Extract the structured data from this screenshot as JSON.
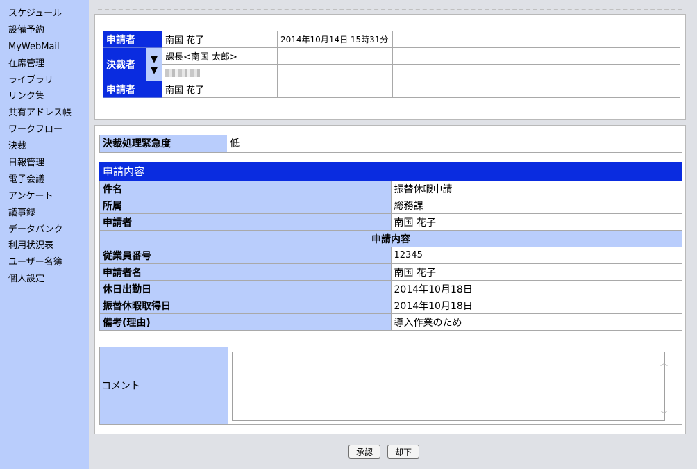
{
  "sidebar": {
    "items": [
      "スケジュール",
      "設備予約",
      "MyWebMail",
      "在席管理",
      "ライブラリ",
      "リンク集",
      "共有アドレス帳",
      "ワークフロー",
      "決裁",
      "日報管理",
      "電子会議",
      "アンケート",
      "議事録",
      "データバンク",
      "利用状況表",
      "ユーザー名簿",
      "個人設定"
    ]
  },
  "route": {
    "applicant_label": "申請者",
    "approver_label": "決裁者",
    "applicant_name": "南国 花子",
    "applied_at": "2014年10月14日 15時31分",
    "approver1": "課長<南国 太郎>",
    "final_label": "申請者",
    "final_name": "南国 花子",
    "arrow": "▼"
  },
  "urgency": {
    "label": "決裁処理緊急度",
    "value": "低"
  },
  "details": {
    "title": "申請内容",
    "rows": [
      {
        "k": "件名",
        "v": "振替休暇申請"
      },
      {
        "k": "所属",
        "v": "総務課"
      },
      {
        "k": "申請者",
        "v": "南国 花子"
      }
    ],
    "subheader": "申請内容",
    "rows2": [
      {
        "k": "従業員番号",
        "v": "12345"
      },
      {
        "k": "申請者名",
        "v": "南国 花子"
      },
      {
        "k": "休日出勤日",
        "v": "2014年10月18日"
      },
      {
        "k": "振替休暇取得日",
        "v": "2014年10月18日"
      },
      {
        "k": "備考(理由)",
        "v": "導入作業のため"
      }
    ]
  },
  "comment": {
    "label": "コメント",
    "value": "",
    "up": "︿",
    "down": "﹀"
  },
  "buttons": {
    "approve": "承認",
    "reject": "却下"
  },
  "colors": {
    "accent": "#0a2ce0",
    "sidebar": "#b9cdfc"
  }
}
